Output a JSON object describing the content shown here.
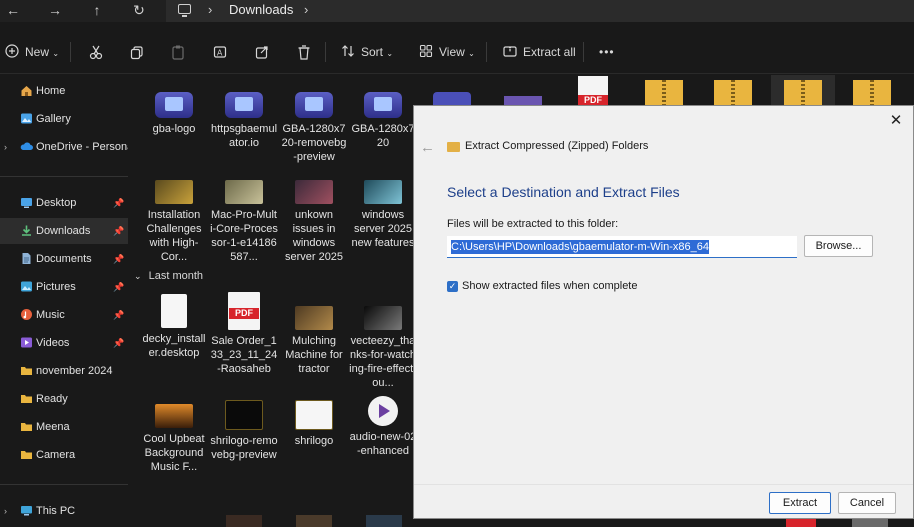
{
  "addressbar": {
    "back": "←",
    "forward": "→",
    "up": "↑",
    "refresh": "↻",
    "crumb": "Downloads"
  },
  "toolbar": {
    "new_label": "New",
    "sort_label": "Sort",
    "view_label": "View",
    "extract_all_label": "Extract all",
    "more_label": "•••"
  },
  "sidebar": {
    "items": [
      {
        "label": "Home"
      },
      {
        "label": "Gallery"
      },
      {
        "label": "OneDrive - Persona"
      },
      {
        "label": "Desktop"
      },
      {
        "label": "Downloads"
      },
      {
        "label": "Documents"
      },
      {
        "label": "Pictures"
      },
      {
        "label": "Music"
      },
      {
        "label": "Videos"
      },
      {
        "label": "november 2024"
      },
      {
        "label": "Ready"
      },
      {
        "label": "Meena"
      },
      {
        "label": "Camera"
      },
      {
        "label": "This PC"
      }
    ]
  },
  "files": {
    "row1": [
      {
        "name": "gba-logo"
      },
      {
        "name": "httpsgbaemulator.io"
      },
      {
        "name": "GBA-1280x720-removebg-preview"
      },
      {
        "name": "GBA-1280x720"
      }
    ],
    "row2": [
      {
        "name": "Installation Challenges with High-Cor..."
      },
      {
        "name": "Mac-Pro-Multi-Core-Processor-1-e14186587..."
      },
      {
        "name": "unkown issues in windows server 2025"
      },
      {
        "name": "windows server 2025 new features"
      }
    ],
    "group_label": "Last month",
    "row3": [
      {
        "name": "decky_installer.desktop"
      },
      {
        "name": "Sale Order_133_23_11_24-Raosaheb"
      },
      {
        "name": "Mulching Machine for tractor"
      },
      {
        "name": "vecteezy_thanks-for-watching-fire-effect-ou..."
      }
    ],
    "row4": [
      {
        "name": "Cool Upbeat Background Music F..."
      },
      {
        "name": "shrilogo-removebg-preview"
      },
      {
        "name": "shrilogo"
      },
      {
        "name": "audio-new-02-enhanced"
      }
    ]
  },
  "dialog": {
    "title": "Extract Compressed (Zipped) Folders",
    "heading": "Select a Destination and Extract Files",
    "label": "Files will be extracted to this folder:",
    "path": "C:\\Users\\HP\\Downloads\\gbaemulator-m-Win-x86_64",
    "browse_label": "Browse...",
    "checkbox_label": "Show extracted files when complete",
    "checkbox_checked": true,
    "extract_label": "Extract",
    "cancel_label": "Cancel",
    "close": "✕",
    "back": "←"
  }
}
